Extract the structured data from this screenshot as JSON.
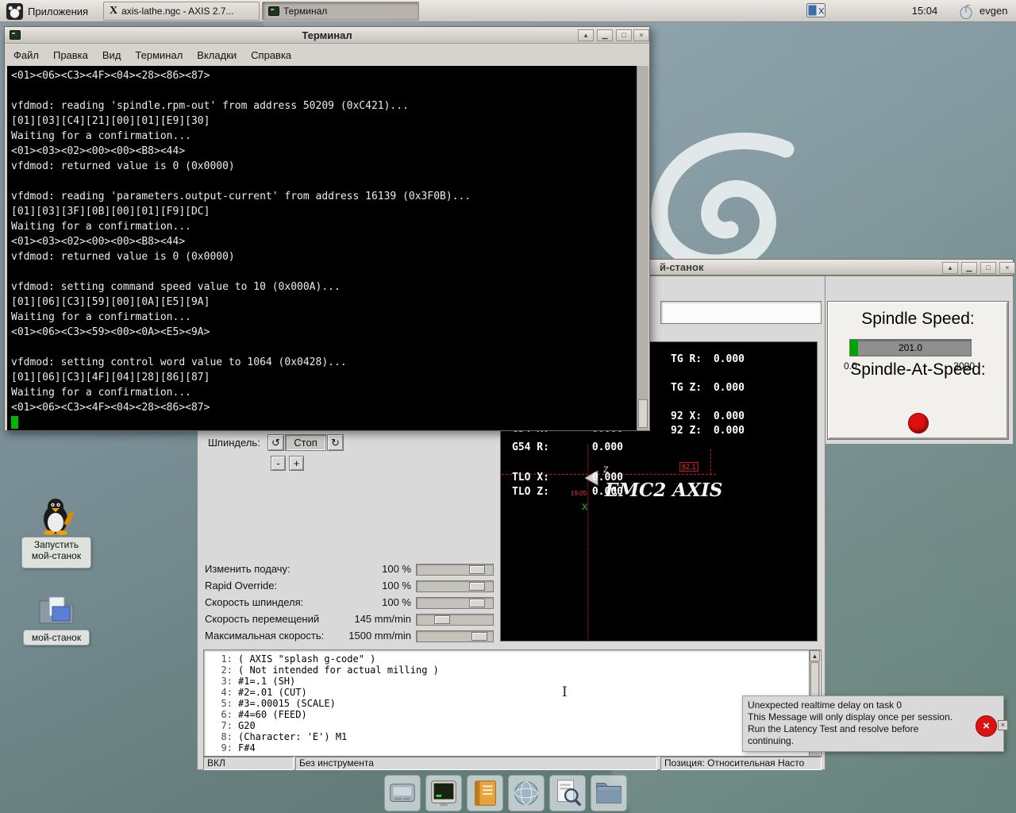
{
  "taskbar": {
    "applications": "Приложения",
    "window_buttons": [
      {
        "label": "axis-lathe.ngc - AXIS 2.7..."
      },
      {
        "label": "Терминал"
      }
    ],
    "clock": "15:04",
    "username": "evgen"
  },
  "window_controls": {
    "shade": "▴",
    "minimize": "▁",
    "maximize": "□",
    "close": "×"
  },
  "icons": {
    "scroll_up": "▲",
    "spindle_ccw": "↺",
    "spindle_cw": "↻"
  },
  "terminal": {
    "title": "Терминал",
    "menu": [
      "Файл",
      "Правка",
      "Вид",
      "Терминал",
      "Вкладки",
      "Справка"
    ],
    "lines": [
      "<01><06><C3><4F><04><28><86><87>",
      "",
      "vfdmod: reading 'spindle.rpm-out' from address 50209 (0xC421)...",
      "[01][03][C4][21][00][01][E9][30]",
      "Waiting for a confirmation...",
      "<01><03><02><00><00><B8><44>",
      "vfdmod: returned value is 0 (0x0000)",
      "",
      "vfdmod: reading 'parameters.output-current' from address 16139 (0x3F0B)...",
      "[01][03][3F][0B][00][01][F9][DC]",
      "Waiting for a confirmation...",
      "<01><03><02><00><00><B8><44>",
      "vfdmod: returned value is 0 (0x0000)",
      "",
      "vfdmod: setting command speed value to 10 (0x000A)...",
      "[01][06][C3][59][00][0A][E5][9A]",
      "Waiting for a confirmation...",
      "<01><06><C3><59><00><0A><E5><9A>",
      "",
      "vfdmod: setting control word value to 1064 (0x0428)...",
      "[01][06][C3][4F][04][28][86][87]",
      "Waiting for a confirmation...",
      "<01><06><C3><4F><04><28><86><87>"
    ]
  },
  "axis": {
    "title_visible": "й-станок",
    "spindle_label": "Шпиндель:",
    "stop_label": "Стоп",
    "minus_label": "-",
    "plus_label": "+",
    "sliders": [
      {
        "label": "Изменить подачу:",
        "value": "100 %",
        "pos": 0.85
      },
      {
        "label": "Rapid Override:",
        "value": "100 %",
        "pos": 0.85
      },
      {
        "label": "Скорость шпинделя:",
        "value": "100 %",
        "pos": 0.85
      },
      {
        "label": "Скорость перемещений",
        "value": "145 mm/min",
        "pos": 0.27
      },
      {
        "label": "Максимальная скорость:",
        "value": "1500 mm/min",
        "pos": 0.9
      }
    ],
    "dro_right": [
      {
        "label": "TG R:",
        "value": "0.000"
      },
      {
        "label": "TG Z:",
        "value": "0.000"
      },
      {
        "label": "92 X:",
        "value": "0.000"
      },
      {
        "label": "92 Z:",
        "value": "0.000"
      }
    ],
    "dro_left": [
      {
        "label": "G54 X:",
        "value": "0.000"
      },
      {
        "label": "G54 R:",
        "value": "0.000"
      },
      {
        "label": "TLO X:",
        "value": "0.000"
      },
      {
        "label": "TLO Z:",
        "value": "0.000"
      }
    ],
    "preview": {
      "dim_width": "82.1",
      "dim_height": "19.05",
      "axis_x": "X",
      "axis_z": "Z",
      "watermark": "EMC2 AXIS"
    },
    "gcode": [
      {
        "n": "1:",
        "t": "( AXIS \"splash g-code\" )"
      },
      {
        "n": "2:",
        "t": "( Not intended for actual milling )"
      },
      {
        "n": "3:",
        "t": "#1=.1 (SH)"
      },
      {
        "n": "4:",
        "t": "#2=.01 (CUT)"
      },
      {
        "n": "5:",
        "t": "#3=.00015 (SCALE)"
      },
      {
        "n": "6:",
        "t": "#4=60 (FEED)"
      },
      {
        "n": "7:",
        "t": "G20"
      },
      {
        "n": "8:",
        "t": "(Character: 'E') M1"
      },
      {
        "n": "9:",
        "t": "F#4"
      }
    ],
    "status": {
      "power": "ВКЛ",
      "tool": "Без инструмента",
      "position": "Позиция: Относительная Насто"
    }
  },
  "spindle_panel": {
    "title": "Spindle Speed:",
    "value": "201.0",
    "min": "0.0",
    "max": "3000",
    "fraction": 0.067,
    "at_speed_label": "Spindle-At-Speed:"
  },
  "error_popup": {
    "line1": "Unexpected realtime delay on task 0",
    "line2": "This Message will only display once per session.",
    "line3": "Run the Latency Test and resolve before",
    "line4": "continuing.",
    "close": "×"
  },
  "desktop": {
    "launcher_line1": "Запустить",
    "launcher_line2": "мой-станок",
    "folder_label": "мой-станок"
  },
  "colors": {
    "led_red": "#e01010",
    "bar_green": "#00a400"
  }
}
